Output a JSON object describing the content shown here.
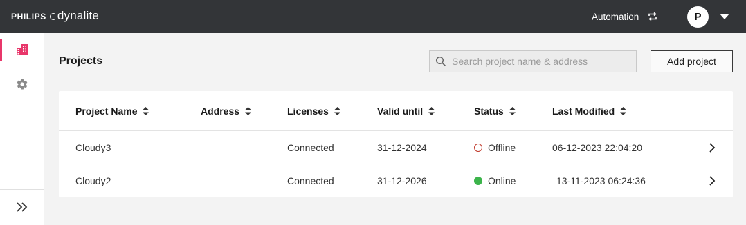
{
  "header": {
    "brand_primary": "PHILIPS",
    "brand_secondary": "dynalite",
    "automation_label": "Automation",
    "avatar_initial": "P"
  },
  "page": {
    "title": "Projects",
    "search_placeholder": "Search project name & address",
    "add_button_label": "Add project"
  },
  "table": {
    "columns": [
      "Project Name",
      "Address",
      "Licenses",
      "Valid until",
      "Status",
      "Last Modified"
    ],
    "rows": [
      {
        "name": "Cloudy3",
        "address": "",
        "licenses": "Connected",
        "valid_until": "31-12-2024",
        "status": "Offline",
        "last_modified": "06-12-2023 22:04:20"
      },
      {
        "name": "Cloudy2",
        "address": "",
        "licenses": "Connected",
        "valid_until": "31-12-2026",
        "status": "Online",
        "last_modified": "13-11-2023 06:24:36"
      }
    ]
  },
  "colors": {
    "topbar": "#333538",
    "accent": "#e8366a",
    "online": "#3cb44b",
    "offline": "#c0392b"
  }
}
